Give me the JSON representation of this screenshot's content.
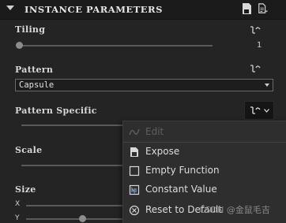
{
  "section": {
    "title": "INSTANCE PARAMETERS"
  },
  "params": {
    "tiling": {
      "label": "Tiling",
      "value": "1",
      "slider_fraction": 0.0
    },
    "pattern": {
      "label": "Pattern",
      "selected": "Capsule"
    },
    "pattern_specific": {
      "label": "Pattern Specific"
    },
    "scale": {
      "label": "Scale"
    },
    "size": {
      "label": "Size",
      "x_label": "X",
      "y_label": "Y",
      "y_fraction": 0.3
    }
  },
  "context_menu": {
    "items": [
      {
        "label": "Edit",
        "icon": "curve-icon",
        "enabled": false
      },
      {
        "label": "Expose",
        "icon": "expose-icon",
        "enabled": true
      },
      {
        "label": "Empty Function",
        "icon": "empty-function-icon",
        "enabled": true
      },
      {
        "label": "Constant Value",
        "icon": "constant-value-icon",
        "enabled": true
      },
      {
        "label": "Reset to Default",
        "icon": "reset-icon",
        "enabled": true
      }
    ]
  },
  "watermark": {
    "text": "CSDN @金鼠毛吉"
  },
  "colors": {
    "background": "#242424",
    "header": "#1b1b1b",
    "menu": "#2e2e2e"
  }
}
